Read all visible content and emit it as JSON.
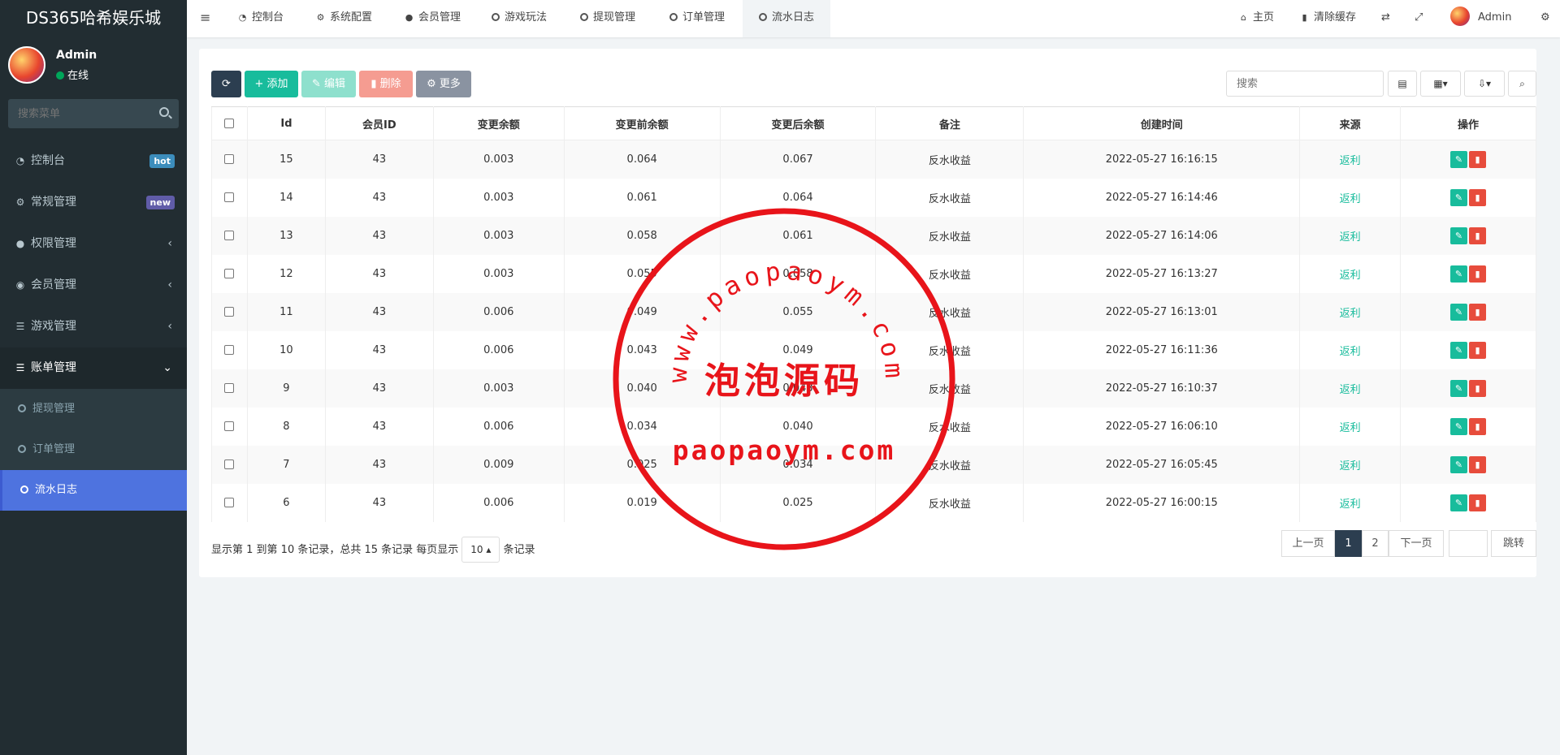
{
  "app": {
    "title": "DS365哈希娱乐城"
  },
  "user": {
    "name": "Admin",
    "status": "在线"
  },
  "sidebar": {
    "search_placeholder": "搜索菜单",
    "items": [
      {
        "label": "控制台",
        "badge": "hot",
        "icon": "dashboard-icon"
      },
      {
        "label": "常规管理",
        "badge": "new",
        "icon": "cogs-icon"
      },
      {
        "label": "权限管理",
        "icon": "users-icon"
      },
      {
        "label": "会员管理",
        "icon": "user-circle-icon"
      },
      {
        "label": "游戏管理",
        "icon": "list-icon"
      },
      {
        "label": "账单管理",
        "icon": "list-icon"
      }
    ],
    "subitems": [
      {
        "label": "提现管理"
      },
      {
        "label": "订单管理"
      },
      {
        "label": "流水日志"
      }
    ]
  },
  "topbar": {
    "tabs": [
      {
        "label": "控制台"
      },
      {
        "label": "系统配置"
      },
      {
        "label": "会员管理"
      },
      {
        "label": "游戏玩法"
      },
      {
        "label": "提现管理"
      },
      {
        "label": "订单管理"
      },
      {
        "label": "流水日志"
      }
    ],
    "home": "主页",
    "clear_cache": "清除缓存",
    "user": "Admin"
  },
  "toolbar": {
    "add": "添加",
    "edit": "编辑",
    "delete": "删除",
    "more": "更多",
    "search_placeholder": "搜索"
  },
  "table": {
    "headers": [
      "Id",
      "会员ID",
      "变更余额",
      "变更前余额",
      "变更后余额",
      "备注",
      "创建时间",
      "来源",
      "操作"
    ],
    "rows": [
      [
        "15",
        "43",
        "0.003",
        "0.064",
        "0.067",
        "反水收益",
        "2022-05-27 16:16:15",
        "返利"
      ],
      [
        "14",
        "43",
        "0.003",
        "0.061",
        "0.064",
        "反水收益",
        "2022-05-27 16:14:46",
        "返利"
      ],
      [
        "13",
        "43",
        "0.003",
        "0.058",
        "0.061",
        "反水收益",
        "2022-05-27 16:14:06",
        "返利"
      ],
      [
        "12",
        "43",
        "0.003",
        "0.055",
        "0.058",
        "反水收益",
        "2022-05-27 16:13:27",
        "返利"
      ],
      [
        "11",
        "43",
        "0.006",
        "0.049",
        "0.055",
        "反水收益",
        "2022-05-27 16:13:01",
        "返利"
      ],
      [
        "10",
        "43",
        "0.006",
        "0.043",
        "0.049",
        "反水收益",
        "2022-05-27 16:11:36",
        "返利"
      ],
      [
        "9",
        "43",
        "0.003",
        "0.040",
        "0.043",
        "反水收益",
        "2022-05-27 16:10:37",
        "返利"
      ],
      [
        "8",
        "43",
        "0.006",
        "0.034",
        "0.040",
        "反水收益",
        "2022-05-27 16:06:10",
        "返利"
      ],
      [
        "7",
        "43",
        "0.009",
        "0.025",
        "0.034",
        "反水收益",
        "2022-05-27 16:05:45",
        "返利"
      ],
      [
        "6",
        "43",
        "0.006",
        "0.019",
        "0.025",
        "反水收益",
        "2022-05-27 16:00:15",
        "返利"
      ]
    ]
  },
  "pagination": {
    "info_before": "显示第 1 到第 10 条记录，总共 15 条记录 每页显示",
    "page_size": "10",
    "info_after": "条记录",
    "prev": "上一页",
    "page1": "1",
    "page2": "2",
    "next": "下一页",
    "jump": "跳转"
  },
  "watermark": {
    "url_arc": "www.paopaoym.com",
    "name": "泡泡源码",
    "url": "paopaoym.com",
    "color": "#e8141a"
  }
}
